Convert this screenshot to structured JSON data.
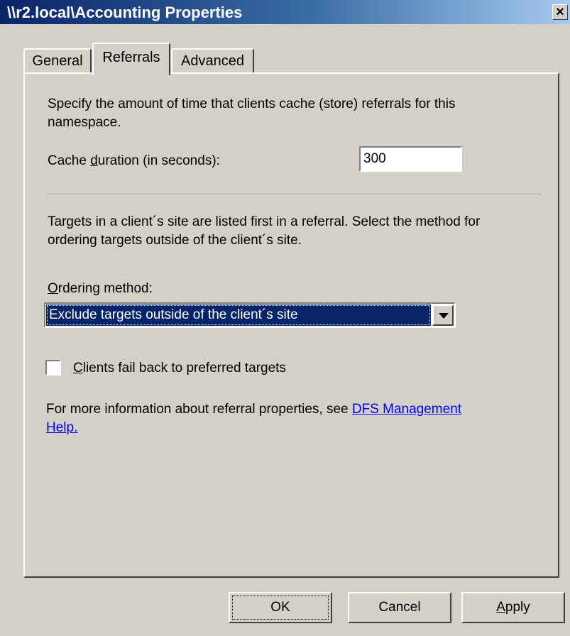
{
  "window": {
    "title": "\\\\r2.local\\Accounting Properties",
    "close_glyph": "×"
  },
  "tabs": [
    {
      "label": "General"
    },
    {
      "label": "Referrals",
      "selected": true
    },
    {
      "label": "Advanced"
    }
  ],
  "referrals": {
    "cache_description_line1": "Specify the amount of time that clients cache (store) referrals for this",
    "cache_description_line2": "namespace.",
    "cache_label_pre": "Cache ",
    "cache_label_accel": "d",
    "cache_label_post": "uration (in seconds):",
    "cache_value": "300",
    "targets_description_line1": "Targets in a client´s site are listed first in a referral. Select the method for",
    "targets_description_line2": "ordering targets outside of the client´s site.",
    "ordering_label_accel": "O",
    "ordering_label_post": "rdering method:",
    "ordering_selected": "Exclude targets outside of the client´s site",
    "failback_label_accel": "C",
    "failback_label_post": "lients fail back to preferred targets",
    "failback_checked": false,
    "info_text": "For more information about referral properties, see ",
    "help_link_line1": "DFS Management",
    "help_link_line2": "Help."
  },
  "buttons": {
    "ok": "OK",
    "cancel": "Cancel",
    "apply_accel": "A",
    "apply_post": "pply"
  },
  "colors": {
    "titlebar_start": "#0a246a",
    "titlebar_end": "#a6caf0",
    "dialog_face": "#d4d0c8",
    "selection": "#0a246a",
    "link": "#0000ff"
  }
}
